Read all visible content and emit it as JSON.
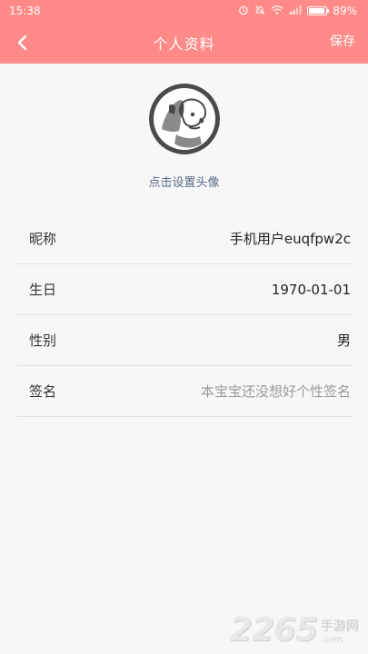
{
  "status_bar": {
    "time": "15:38",
    "battery": "89%",
    "icons": [
      "alarm-icon",
      "mute-icon",
      "wifi-icon",
      "signal-icon",
      "battery-icon"
    ]
  },
  "navbar": {
    "title": "个人资料",
    "save_label": "保存",
    "back_icon": "chevron-left-icon"
  },
  "profile": {
    "avatar_label": "点击设置头像"
  },
  "fields": [
    {
      "label": "昵称",
      "value": "手机用户euqfpw2c",
      "placeholder": false
    },
    {
      "label": "生日",
      "value": "1970-01-01",
      "placeholder": false
    },
    {
      "label": "性别",
      "value": "男",
      "placeholder": false
    },
    {
      "label": "签名",
      "value": "本宝宝还没想好个性签名",
      "placeholder": true
    }
  ],
  "watermark": {
    "number": "2265",
    "site": "手游网",
    "domain": ".com"
  },
  "colors": {
    "header": "#ff8a88",
    "background": "#f7f7f7",
    "link": "#5a6a88"
  }
}
